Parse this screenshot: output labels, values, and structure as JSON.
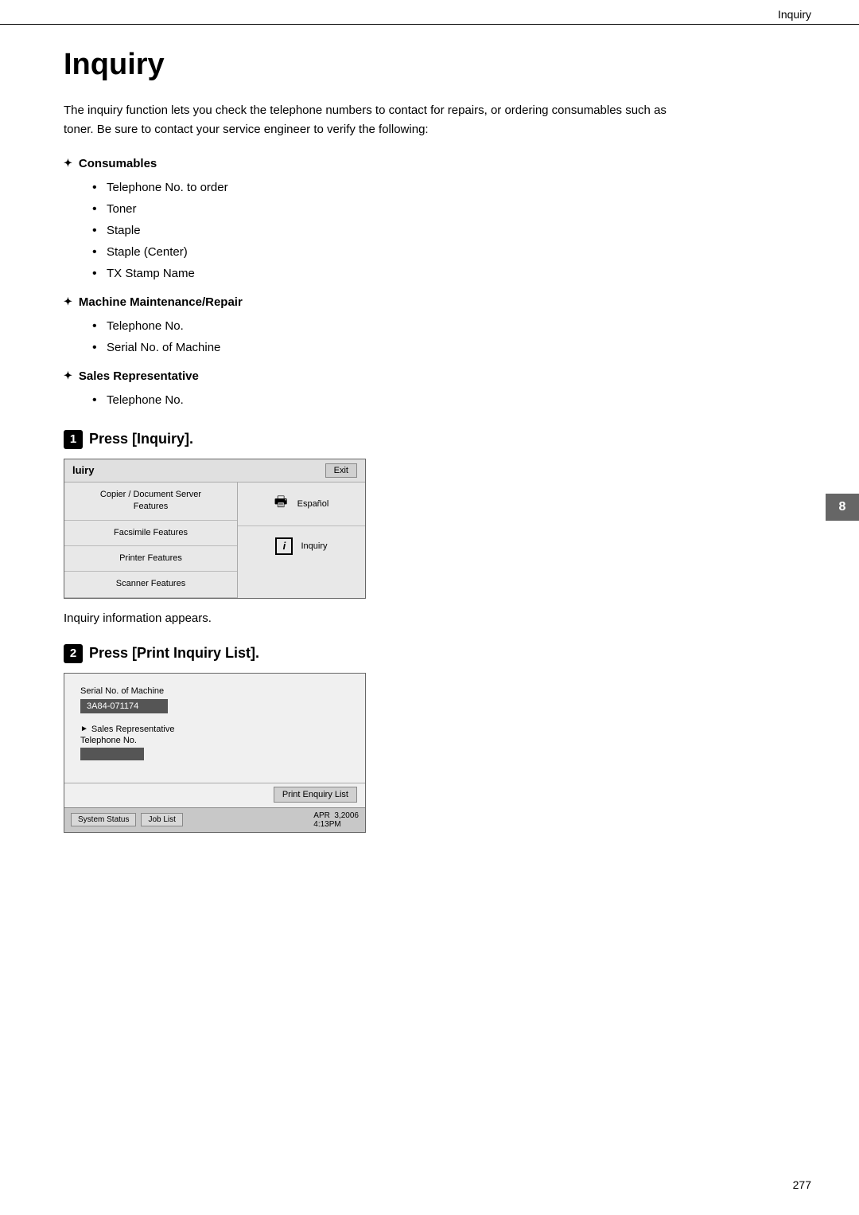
{
  "header": {
    "title": "Inquiry"
  },
  "page": {
    "title": "Inquiry",
    "intro": "The inquiry function lets you check the telephone numbers to contact for repairs, or ordering consumables such as toner. Be sure to contact your service engineer to verify the following:"
  },
  "sections": [
    {
      "id": "consumables",
      "title": "Consumables",
      "items": [
        "Telephone No. to order",
        "Toner",
        "Staple",
        "Staple (Center)",
        "TX Stamp Name"
      ]
    },
    {
      "id": "machine-maintenance",
      "title": "Machine Maintenance/Repair",
      "items": [
        "Telephone No.",
        "Serial No. of Machine"
      ]
    },
    {
      "id": "sales-representative",
      "title": "Sales Representative",
      "items": [
        "Telephone No."
      ]
    }
  ],
  "steps": [
    {
      "number": "1",
      "text": "Press [Inquiry]."
    },
    {
      "number": "2",
      "text": "Press [Print Inquiry List]."
    }
  ],
  "screen1": {
    "title": "luiry",
    "exit_button": "Exit",
    "left_items": [
      "Copier / Document Server\nFeatures",
      "Facsimile Features",
      "Printer Features",
      "Scanner Features"
    ],
    "right_top_text": "Español",
    "right_bottom_text": "Inquiry"
  },
  "info_text": "Inquiry information appears.",
  "screen2": {
    "serial_label": "Serial No. of Machine",
    "serial_value": "3A84-071174",
    "sales_rep_label": "Sales Representative",
    "telephone_label": "Telephone No.",
    "print_button": "Print Enquiry List",
    "status_buttons": [
      "System Status",
      "Job List"
    ],
    "datetime": "APR  3,2006\n4:13PM"
  },
  "page_number": "277",
  "side_tab": "8"
}
